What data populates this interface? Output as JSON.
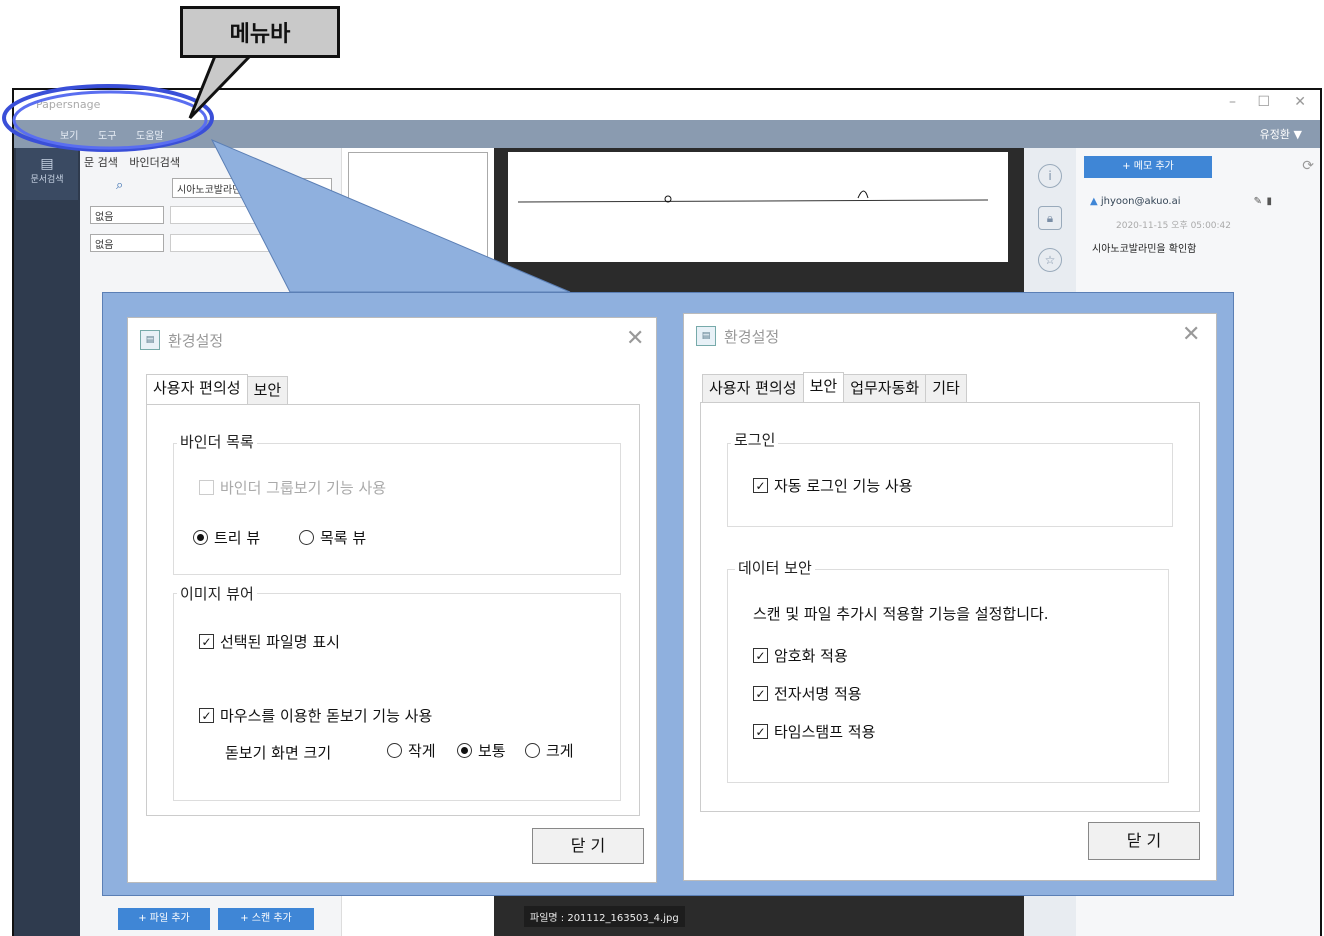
{
  "callout": {
    "label": "메뉴바"
  },
  "app": {
    "title": "Papersnage",
    "window_controls": {
      "minimize": "–",
      "maximize": "☐",
      "close": "✕"
    },
    "menu": [
      "보기",
      "도구",
      "도움말"
    ],
    "user_menu": "유정환 ▼",
    "nav": {
      "item": "문서검색"
    },
    "search": {
      "tabs": [
        "문 검색",
        "바인더검색"
      ],
      "input_value": "시아노코발라민",
      "selects": [
        "없음",
        "없음"
      ]
    },
    "viewer": {
      "filename": "파일명 : 201112_163503_4.jpg"
    },
    "memo": {
      "add_label": "+ 메모 추가",
      "user": "jhyoon@akuo.ai",
      "date": "2020-11-15 오후 05:00:42",
      "text": "시아노코발라민을 확인함"
    },
    "bottom_buttons": {
      "file_add": "+ 파일 추가",
      "scan_add": "+ 스캔 추가"
    }
  },
  "dialog_left": {
    "title": "환경설정",
    "close_icon": "✕",
    "tabs": [
      "사용자 편의성",
      "보안"
    ],
    "active_tab": 0,
    "binder_group": {
      "label": "바인더 목록",
      "group_view": {
        "label": "바인더 그룹보기 기능 사용",
        "checked": false,
        "disabled": true
      },
      "tree_view": "트리 뷰",
      "list_view": "목록 뷰",
      "selected": "트리 뷰"
    },
    "viewer_group": {
      "label": "이미지 뷰어",
      "show_filename": {
        "label": "선택된 파일명 표시",
        "checked": true
      },
      "magnifier": {
        "label": "마우스를 이용한 돋보기 기능 사용",
        "checked": true
      },
      "magnifier_size_label": "돋보기 화면 크기",
      "sizes": [
        "작게",
        "보통",
        "크게"
      ],
      "selected_size": "보통"
    },
    "close_button": "닫 기"
  },
  "dialog_right": {
    "title": "환경설정",
    "close_icon": "✕",
    "tabs": [
      "사용자 편의성",
      "보안",
      "업무자동화",
      "기타"
    ],
    "active_tab": 1,
    "login_group": {
      "label": "로그인",
      "auto_login": {
        "label": "자동 로그인 기능 사용",
        "checked": true
      }
    },
    "data_group": {
      "label": "데이터 보안",
      "description": "스캔 및 파일 추가시 적용할 기능을 설정합니다.",
      "encryption": {
        "label": "암호화 적용",
        "checked": true
      },
      "signature": {
        "label": "전자서명 적용",
        "checked": true
      },
      "timestamp": {
        "label": "타임스탬프 적용",
        "checked": true
      }
    },
    "close_button": "닫 기"
  },
  "colors": {
    "menubar": "#8a9bb0",
    "zoom_frame": "#8fb0de",
    "highlight_circle": "#3a4fd8",
    "accent_button": "#3f86d6"
  }
}
